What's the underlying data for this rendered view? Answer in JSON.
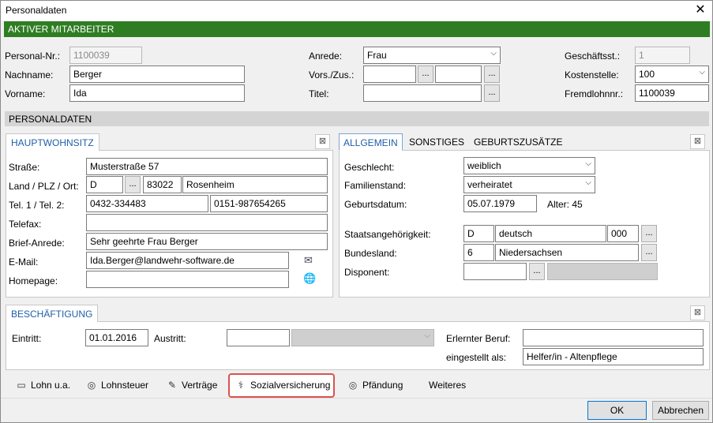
{
  "window": {
    "title": "Personaldaten",
    "close_glyph": "✕"
  },
  "banner": {
    "text": "AKTIVER MITARBEITER",
    "color": "#2e7d22"
  },
  "header_fields": {
    "personal_nr": {
      "label": "Personal-Nr.:",
      "value": "1100039"
    },
    "nachname": {
      "label": "Nachname:",
      "value": "Berger"
    },
    "vorname": {
      "label": "Vorname:",
      "value": "Ida"
    },
    "anrede": {
      "label": "Anrede:",
      "value": "Frau"
    },
    "vors_zus": {
      "label": "Vors./Zus.:",
      "value1": "",
      "value2": ""
    },
    "titel": {
      "label": "Titel:",
      "value": ""
    },
    "geschaeftsst": {
      "label": "Geschäftsst.:",
      "value": "1"
    },
    "kostenstelle": {
      "label": "Kostenstelle:",
      "value": "100"
    },
    "fremdlohnnr": {
      "label": "Fremdlohnnr.:",
      "value": "1100039"
    }
  },
  "sections": {
    "personaldaten": "PERSONALDATEN"
  },
  "hauptwohnsitz": {
    "tab": "HAUPTWOHNSITZ",
    "strasse": {
      "label": "Straße:",
      "value": "Musterstraße 57"
    },
    "land_plz_ort": {
      "label": "Land / PLZ / Ort:",
      "land": "D",
      "plz": "83022",
      "ort": "Rosenheim"
    },
    "tel": {
      "label": "Tel. 1 / Tel. 2:",
      "tel1": "0432-334483",
      "tel2": "0151-987654265"
    },
    "telefax": {
      "label": "Telefax:",
      "value": ""
    },
    "brief_anrede": {
      "label": "Brief-Anrede:",
      "value": "Sehr geehrte Frau Berger"
    },
    "email": {
      "label": "E-Mail:",
      "value": "Ida.Berger@landwehr-software.de"
    },
    "homepage": {
      "label": "Homepage:",
      "value": ""
    }
  },
  "allgemein": {
    "tabs": [
      "ALLGEMEIN",
      "SONSTIGES",
      "GEBURTSZUSÄTZE"
    ],
    "geschlecht": {
      "label": "Geschlecht:",
      "value": "weiblich"
    },
    "familienstand": {
      "label": "Familienstand:",
      "value": "verheiratet"
    },
    "geburtsdatum": {
      "label": "Geburtsdatum:",
      "value": "05.07.1979",
      "alter": "Alter: 45"
    },
    "staatsangehoerigkeit": {
      "label": "Staatsangehörigkeit:",
      "code": "D",
      "name": "deutsch",
      "num": "000"
    },
    "bundesland": {
      "label": "Bundesland:",
      "code": "6",
      "name": "Niedersachsen"
    },
    "disponent": {
      "label": "Disponent:",
      "value": ""
    }
  },
  "beschaeftigung": {
    "tab": "BESCHÄFTIGUNG",
    "eintritt": {
      "label": "Eintritt:",
      "value": "01.01.2016"
    },
    "austritt": {
      "label": "Austritt:",
      "value": ""
    },
    "erlernter_beruf": {
      "label": "Erlernter Beruf:",
      "value": ""
    },
    "eingestellt_als": {
      "label": "eingestellt als:",
      "value": "Helfer/in - Altenpflege"
    }
  },
  "nav": [
    {
      "label": "Lohn u.a.",
      "icon": "money-icon"
    },
    {
      "label": "Lohnsteuer",
      "icon": "coins-icon"
    },
    {
      "label": "Verträge",
      "icon": "contract-icon"
    },
    {
      "label": "Sozialversicherung",
      "icon": "caduceus-icon"
    },
    {
      "label": "Pfändung",
      "icon": "coins-icon"
    },
    {
      "label": "Weiteres",
      "icon": ""
    }
  ],
  "buttons": {
    "ok": "OK",
    "abbrechen": "Abbrechen"
  },
  "symbols": {
    "dots": "...",
    "chevron": "⌵",
    "collapse": "⊠",
    "mail": "✉",
    "globe": "🌐"
  }
}
